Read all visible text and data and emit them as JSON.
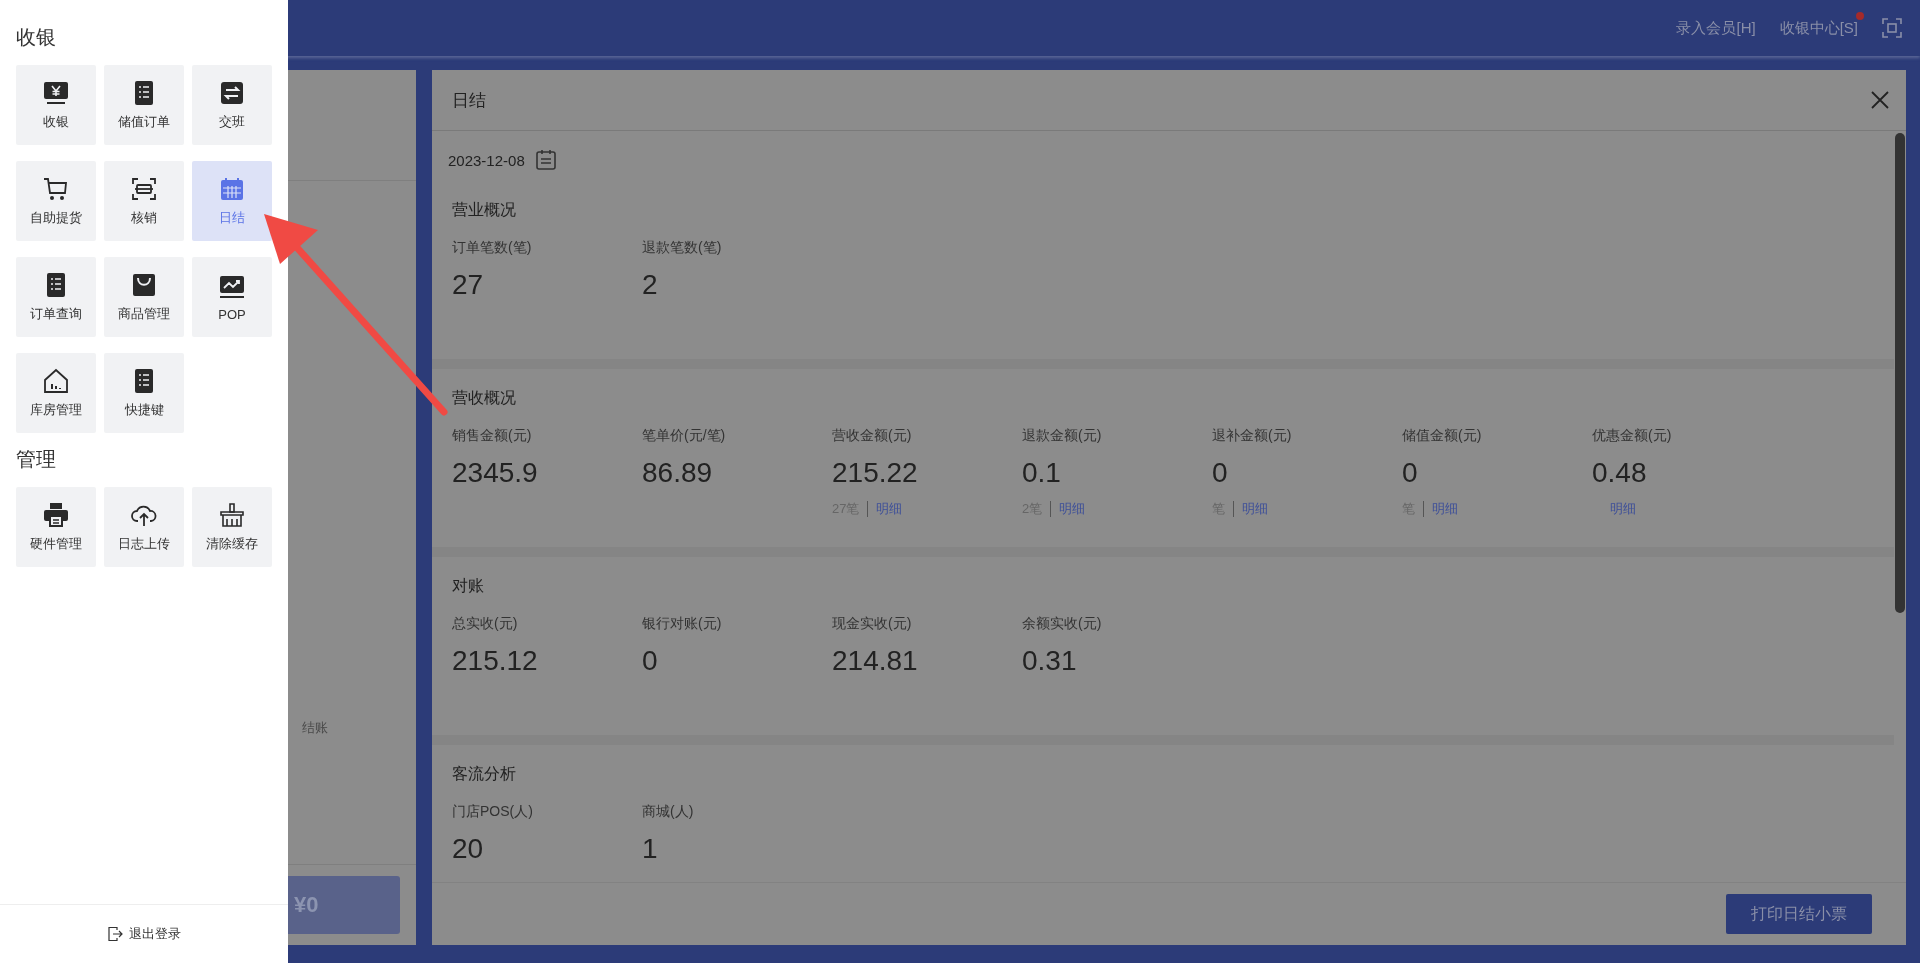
{
  "top_bar": {
    "links": [
      {
        "label": "录入会员[H]",
        "badge": false
      },
      {
        "label": "收银中心[S]",
        "badge": true
      }
    ]
  },
  "drawer": {
    "groups": [
      {
        "title": "收银",
        "items": [
          {
            "label": "收银",
            "selected": false
          },
          {
            "label": "储值订单",
            "selected": false
          },
          {
            "label": "交班",
            "selected": false
          },
          {
            "label": "自助提货",
            "selected": false
          },
          {
            "label": "核销",
            "selected": false
          },
          {
            "label": "日结",
            "selected": true
          },
          {
            "label": "订单查询",
            "selected": false
          },
          {
            "label": "商品管理",
            "selected": false
          },
          {
            "label": "POP",
            "selected": false
          },
          {
            "label": "库房管理",
            "selected": false
          },
          {
            "label": "快捷键",
            "selected": false
          }
        ]
      },
      {
        "title": "管理",
        "items": [
          {
            "label": "硬件管理",
            "selected": false
          },
          {
            "label": "日志上传",
            "selected": false
          },
          {
            "label": "清除缓存",
            "selected": false
          }
        ]
      }
    ],
    "logout": "退出登录"
  },
  "background_panel": {
    "text": "结账",
    "amount": "¥0"
  },
  "dialog": {
    "title": "日结",
    "date": "2023-12-08",
    "sections": [
      {
        "title": "营业概况",
        "metrics": [
          {
            "label": "订单笔数(笔)",
            "value": "27"
          },
          {
            "label": "退款笔数(笔)",
            "value": "2"
          }
        ]
      },
      {
        "title": "营收概况",
        "metrics": [
          {
            "label": "销售金额(元)",
            "value": "2345.9"
          },
          {
            "label": "笔单价(元/笔)",
            "value": "86.89"
          },
          {
            "label": "营收金额(元)",
            "value": "215.22",
            "count": "27笔",
            "link": "明细"
          },
          {
            "label": "退款金额(元)",
            "value": "0.1",
            "count": "2笔",
            "link": "明细"
          },
          {
            "label": "退补金额(元)",
            "value": "0",
            "count": "笔",
            "link": "明细"
          },
          {
            "label": "储值金额(元)",
            "value": "0",
            "count": "笔",
            "link": "明细"
          },
          {
            "label": "优惠金额(元)",
            "value": "0.48",
            "link": "明细"
          }
        ]
      },
      {
        "title": "对账",
        "metrics": [
          {
            "label": "总实收(元)",
            "value": "215.12"
          },
          {
            "label": "银行对账(元)",
            "value": "0"
          },
          {
            "label": "现金实收(元)",
            "value": "214.81"
          },
          {
            "label": "余额实收(元)",
            "value": "0.31"
          }
        ]
      },
      {
        "title": "客流分析",
        "metrics": [
          {
            "label": "门店POS(人)",
            "value": "20"
          },
          {
            "label": "商城(人)",
            "value": "1"
          }
        ]
      }
    ],
    "print_button": "打印日结小票"
  }
}
